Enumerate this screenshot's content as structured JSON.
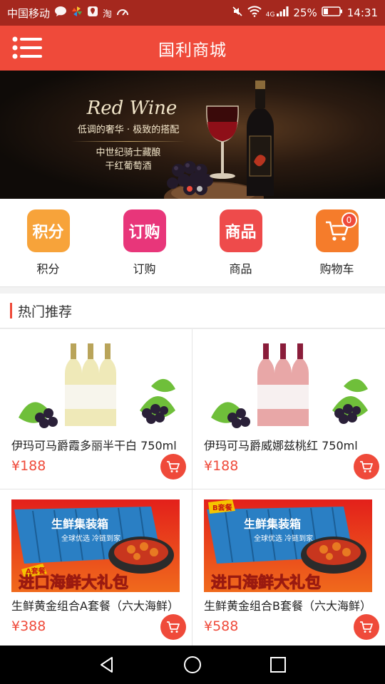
{
  "status_bar": {
    "carrier": "中国移动",
    "taobao_label": "淘",
    "network_label": "4G",
    "battery": "25%",
    "time": "14:31"
  },
  "header": {
    "title": "国利商城"
  },
  "banner": {
    "script_title": "Red Wine",
    "slogan": "低调的奢华 · 极致的搭配",
    "sub_line1": "中世纪骑士藏酿",
    "sub_line2": "干红葡萄酒",
    "active_dot": 0
  },
  "quick_nav": [
    {
      "label": "积分",
      "icon_text": "积分",
      "icon": "points-icon",
      "color": "#f7a33a"
    },
    {
      "label": "订购",
      "icon_text": "订购",
      "icon": "order-icon",
      "color": "#e8367a"
    },
    {
      "label": "商品",
      "icon_text": "商品",
      "icon": "goods-icon",
      "color": "#ee4b4b"
    },
    {
      "label": "购物车",
      "icon_text": "",
      "icon": "cart-icon",
      "color": "#f57c2b",
      "badge": "0"
    }
  ],
  "section": {
    "title": "热门推荐"
  },
  "products": [
    {
      "name": "伊玛可马爵霞多丽半干白 750ml",
      "price": "¥188",
      "image": "white-wine-image"
    },
    {
      "name": "伊玛可马爵威娜兹桃红 750ml",
      "price": "¥188",
      "image": "rose-wine-image"
    },
    {
      "name": "生鲜黄金组合A套餐（六大海鲜）",
      "price": "¥388",
      "image": "seafood-a-image",
      "box_label": "生鲜集装箱",
      "box_sub": "全球优选 冷链到家",
      "promo": "进口海鲜大礼包",
      "tag": "A套餐"
    },
    {
      "name": "生鲜黄金组合B套餐（六大海鲜）",
      "price": "¥588",
      "image": "seafood-b-image",
      "box_label": "生鲜集装箱",
      "box_sub": "全球优选 冷链到家",
      "promo": "进口海鲜大礼包",
      "tag": "B套餐"
    }
  ],
  "colors": {
    "accent": "#ef4a3a",
    "status_bar": "#a5281e"
  }
}
